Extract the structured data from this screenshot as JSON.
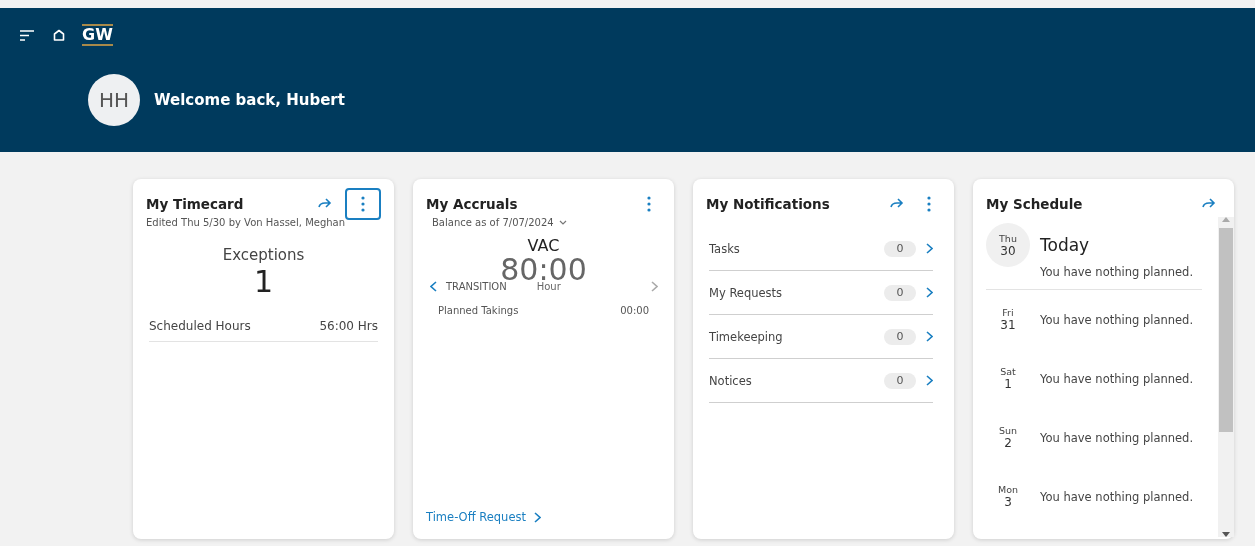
{
  "header": {
    "logo": "GW",
    "avatar": "HH",
    "welcome": "Welcome back, Hubert"
  },
  "timecard": {
    "title": "My Timecard",
    "menu_focused": true,
    "edited": "Edited Thu 5/30 by Von Hassel, Meghan",
    "exceptions_label": "Exceptions",
    "exceptions": "1",
    "hours_label": "Scheduled Hours",
    "hours": "56:00 Hrs"
  },
  "accruals": {
    "title": "My Accruals",
    "balance": "Balance as of 7/07/2024",
    "code": "VAC",
    "amount": "80:00",
    "unit": "Hour",
    "nav_label": "TRANSITION",
    "planned_label": "Planned Takings",
    "planned": "00:00",
    "link": "Time-Off Request"
  },
  "notifications": {
    "title": "My Notifications",
    "items": [
      {
        "label": "Tasks",
        "count": "0"
      },
      {
        "label": "My Requests",
        "count": "0"
      },
      {
        "label": "Timekeeping",
        "count": "0"
      },
      {
        "label": "Notices",
        "count": "0"
      }
    ]
  },
  "schedule": {
    "title": "My Schedule",
    "today": {
      "weekday": "Thu",
      "day": "30",
      "label": "Today",
      "note": "You have nothing planned."
    },
    "days": [
      {
        "weekday": "Fri",
        "day": "31",
        "note": "You have nothing planned."
      },
      {
        "weekday": "Sat",
        "day": "1",
        "note": "You have nothing planned."
      },
      {
        "weekday": "Sun",
        "day": "2",
        "note": "You have nothing planned."
      },
      {
        "weekday": "Mon",
        "day": "3",
        "note": "You have nothing planned."
      }
    ]
  }
}
